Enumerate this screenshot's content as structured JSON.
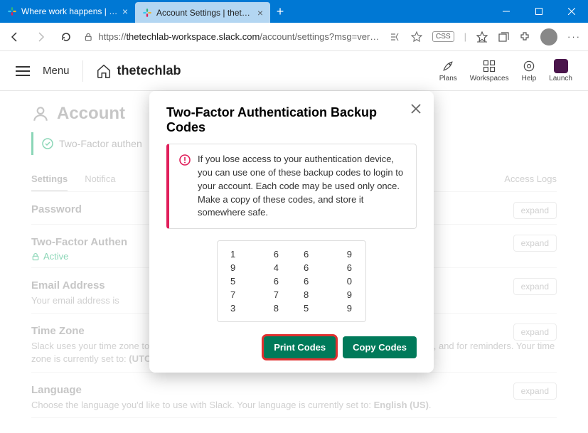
{
  "browser": {
    "tabs": [
      {
        "title": "Where work happens | Slack"
      },
      {
        "title": "Account Settings | thetechlab Sla…"
      }
    ],
    "url_prefix": "https://",
    "url_domain": "thetechlab-workspace.slack.com",
    "url_path": "/account/settings?msg=verified_two…",
    "css_label": "CSS"
  },
  "slack_header": {
    "menu": "Menu",
    "workspace": "thetechlab",
    "actions": {
      "plans": "Plans",
      "workspaces": "Workspaces",
      "help": "Help",
      "launch": "Launch"
    }
  },
  "page": {
    "title": "Account",
    "banner": "Two-Factor authen",
    "tabs": {
      "settings": "Settings",
      "notifications": "Notifica",
      "access_logs": "Access Logs"
    },
    "sections": {
      "password": {
        "title": "Password",
        "expand": "expand"
      },
      "twofa": {
        "title": "Two-Factor Authen",
        "status": "Active",
        "expand": "expand"
      },
      "email": {
        "title": "Email Address",
        "desc": "Your email address is",
        "expand": "expand"
      },
      "timezone": {
        "title": "Time Zone",
        "desc_a": "Slack uses your time zone to send summary and notification emails, for times in your activity feeds, and for reminders. Your time zone is currently set to: ",
        "value": "(UTC-05:00) Eastern Time (US and Canada)",
        "expand": "expand"
      },
      "language": {
        "title": "Language",
        "desc_a": "Choose the language you'd like to use with Slack. Your language is currently set to: ",
        "value": "English (US)",
        "expand": "expand"
      }
    }
  },
  "modal": {
    "title": "Two-Factor Authentication Backup Codes",
    "info": "If you lose access to your authentication device, you can use one of these backup codes to login to your account. Each code may be used only once. Make a copy of these codes, and store it somewhere safe.",
    "codes": [
      [
        "1␣",
        "␣6",
        "6␣",
        "␣9"
      ],
      [
        "9␣",
        "␣4",
        "6␣",
        "␣6"
      ],
      [
        "5␣",
        "␣6",
        "6␣",
        "␣0"
      ],
      [
        "7␣",
        "␣7",
        "8␣",
        "␣9"
      ],
      [
        "3␣",
        "␣8",
        "5␣",
        "␣9"
      ]
    ],
    "print": "Print Codes",
    "copy": "Copy Codes"
  }
}
